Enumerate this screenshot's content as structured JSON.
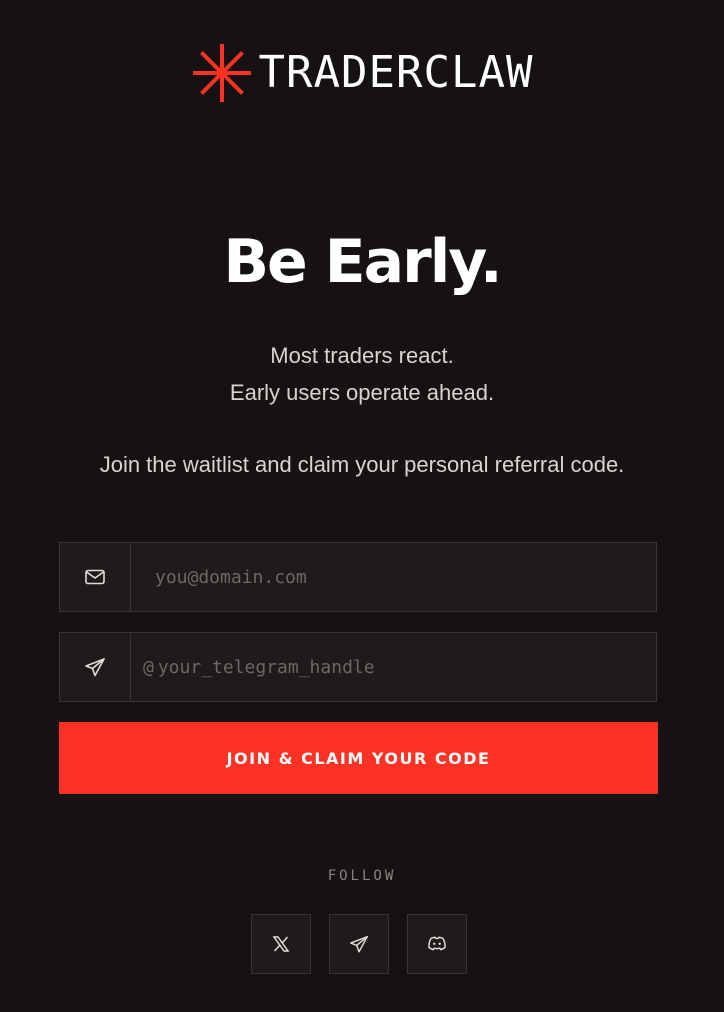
{
  "brand": {
    "wordmark": "TRADERCLAW",
    "accent_color": "#fc3224",
    "logo_icon": "asterisk-burst-icon"
  },
  "hero": {
    "headline": "Be Early.",
    "subtitle_line1": "Most traders react.",
    "subtitle_line2": "Early users operate ahead.",
    "subtitle_line3": "Join the waitlist and claim your personal referral code."
  },
  "form": {
    "email": {
      "icon": "mail-icon",
      "placeholder": "you@domain.com",
      "value": ""
    },
    "telegram": {
      "icon": "telegram-icon",
      "prefix": "@",
      "placeholder": "your_telegram_handle",
      "value": ""
    },
    "submit_label": "JOIN & CLAIM YOUR CODE"
  },
  "footer": {
    "follow_label": "FOLLOW",
    "social": [
      {
        "name": "x-icon"
      },
      {
        "name": "telegram-icon"
      },
      {
        "name": "discord-icon"
      }
    ]
  },
  "colors": {
    "background": "#161212",
    "field_background": "#211a1a",
    "border": "#3a3332",
    "cta": "#fc3224"
  }
}
